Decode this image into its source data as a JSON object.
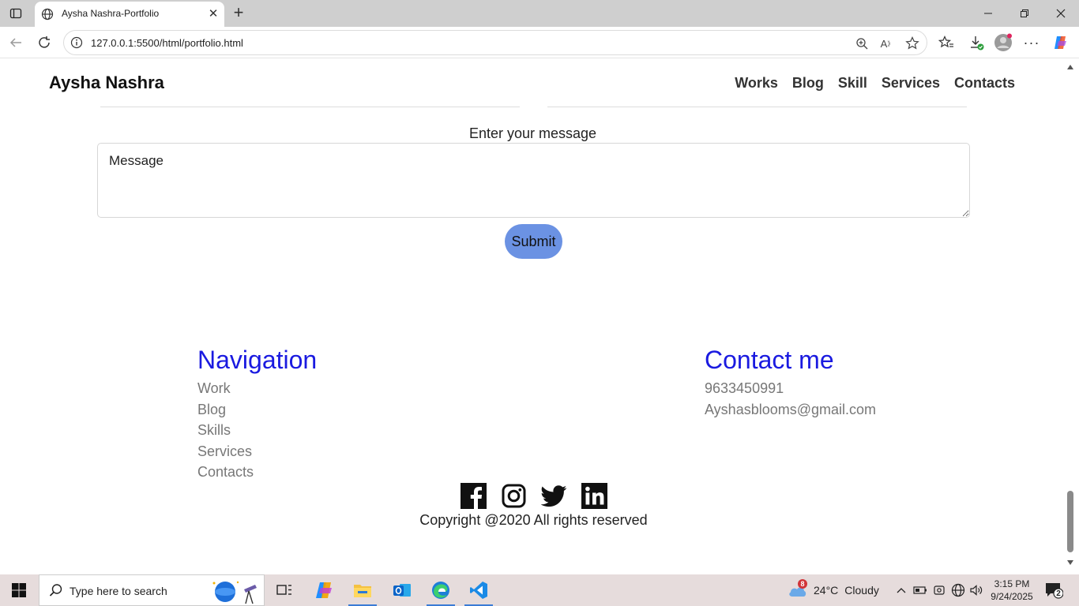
{
  "browser": {
    "tab_title": "Aysha Nashra-Portfolio",
    "url": "127.0.0.1:5500/html/portfolio.html"
  },
  "site": {
    "logo": "Aysha Nashra",
    "nav": [
      "Works",
      "Blog",
      "Skill",
      "Services",
      "Contacts"
    ]
  },
  "form": {
    "message_label": "Enter your message",
    "message_placeholder": "Message",
    "submit_label": "Submit"
  },
  "footer": {
    "navigation": {
      "heading": "Navigation",
      "links": [
        "Work",
        "Blog",
        "Skills",
        "Services",
        "Contacts"
      ]
    },
    "contact": {
      "heading": "Contact me",
      "phone": "9633450991",
      "email": "Ayshasblooms@gmail.com"
    },
    "socials": [
      "facebook-icon",
      "instagram-icon",
      "twitter-icon",
      "linkedin-icon"
    ],
    "copyright": "Copyright @2020 All rights reserved"
  },
  "taskbar": {
    "search_placeholder": "Type here to search",
    "weather_temp": "24°C",
    "weather_desc": "Cloudy",
    "weather_badge": "8",
    "time": "3:15 PM",
    "date": "9/24/2025",
    "notification_count": "2"
  },
  "colors": {
    "heading_blue": "#1a1ae0",
    "submit_bg": "#6b92e3",
    "footer_link": "#777777"
  }
}
